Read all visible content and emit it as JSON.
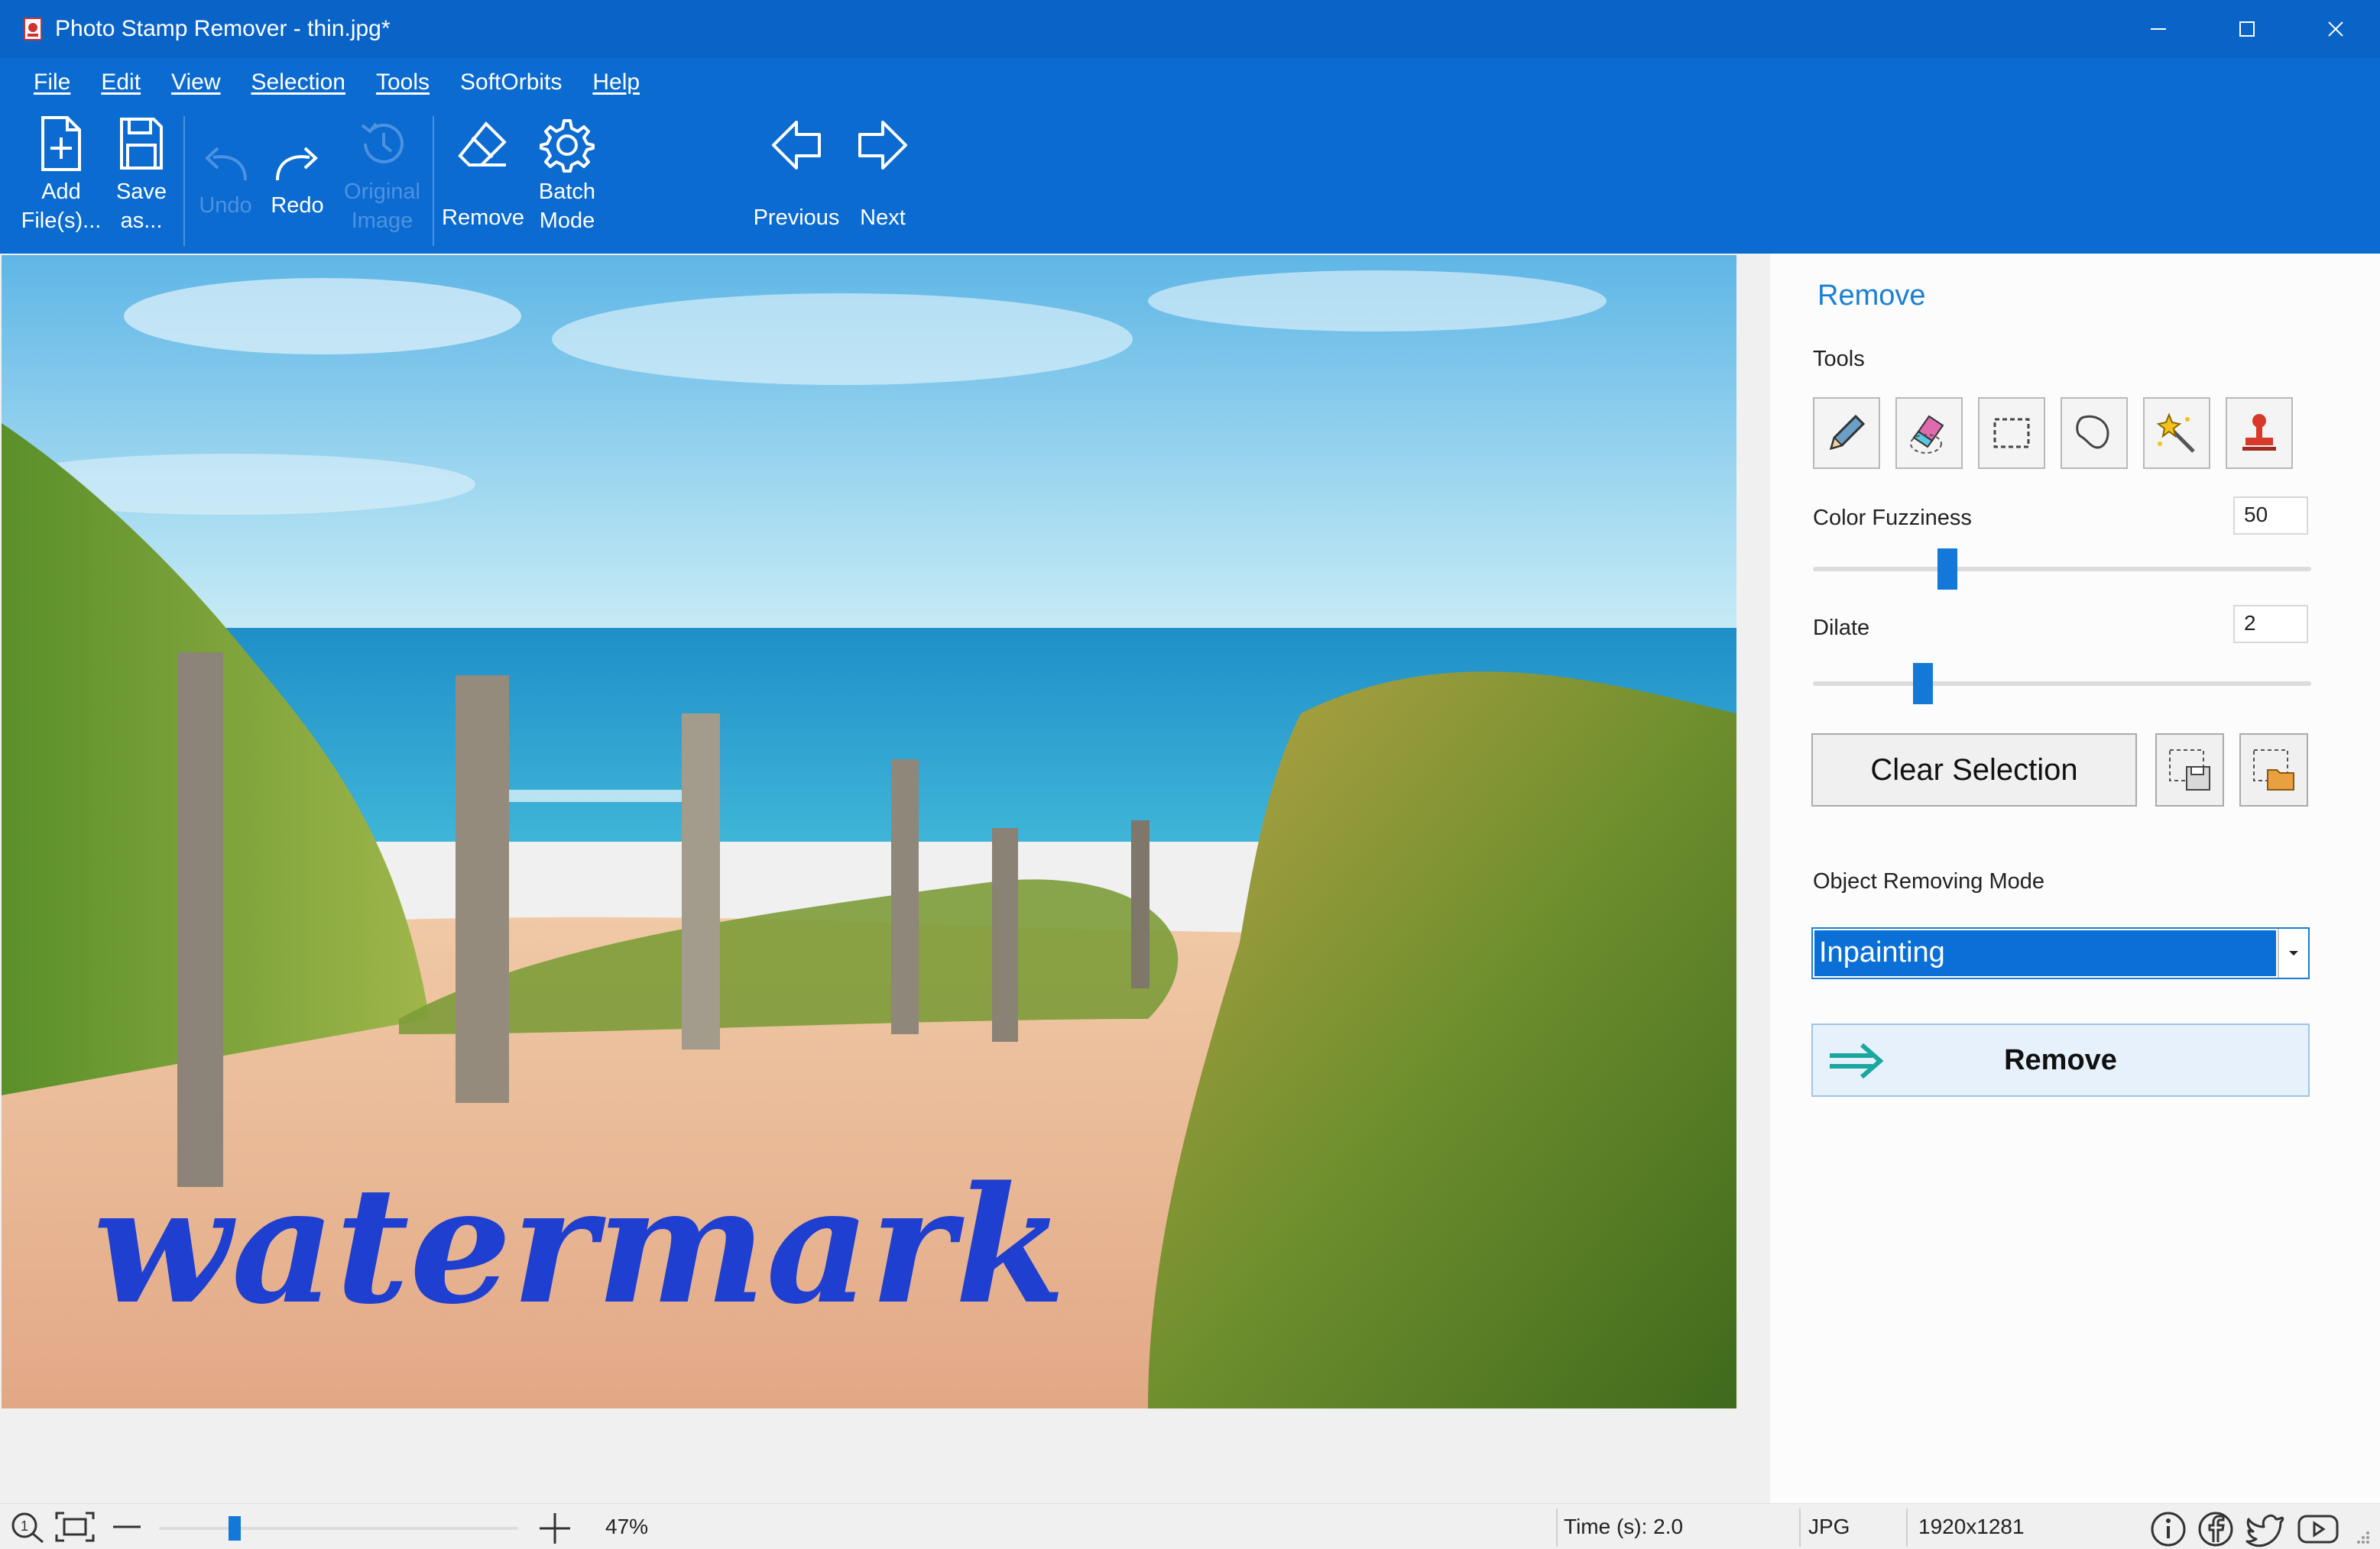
{
  "window": {
    "title": "Photo Stamp Remover - thin.jpg*",
    "controls": [
      "minimize",
      "maximize",
      "close"
    ]
  },
  "menu": [
    "File",
    "Edit",
    "View",
    "Selection",
    "Tools",
    "SoftOrbits",
    "Help"
  ],
  "toolbar": {
    "add_files_1": "Add",
    "add_files_2": "File(s)...",
    "save_as_1": "Save",
    "save_as_2": "as...",
    "undo": "Undo",
    "redo": "Redo",
    "original_image_1": "Original",
    "original_image_2": "Image",
    "remove": "Remove",
    "batch_mode_1": "Batch",
    "batch_mode_2": "Mode",
    "previous": "Previous",
    "next": "Next"
  },
  "canvas": {
    "watermark_text": "watermark",
    "watermark_color": "#1e3fd0"
  },
  "panel": {
    "title": "Remove",
    "tools_label": "Tools",
    "tools": [
      "pencil-icon",
      "eraser-icon",
      "rect-select-icon",
      "lasso-icon",
      "magic-wand-icon",
      "stamp-icon"
    ],
    "color_fuzziness_label": "Color Fuzziness",
    "color_fuzziness_value": "50",
    "color_fuzziness_level": 0.26,
    "dilate_label": "Dilate",
    "dilate_value": "2",
    "dilate_level": 0.21,
    "clear_selection": "Clear Selection",
    "mode_label": "Object Removing Mode",
    "mode_value": "Inpainting",
    "remove_button": "Remove",
    "accent": "#1a7fd4"
  },
  "status": {
    "zoom": "47%",
    "zoom_level": 0.2,
    "time": "Time (s): 2.0",
    "format": "JPG",
    "dimensions": "1920x1281"
  },
  "colors": {
    "titlebar": "#0a64c8",
    "toolbar": "#0b6bd0",
    "accent": "#1478d8"
  }
}
